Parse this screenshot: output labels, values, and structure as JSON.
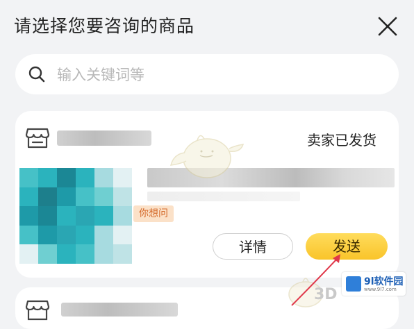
{
  "header": {
    "title": "请选择您要咨询的商品"
  },
  "search": {
    "placeholder": "输入关键词等"
  },
  "orders": [
    {
      "status": "卖家已发货",
      "ask_tag": "你想问",
      "detail_label": "详情",
      "send_label": "发送"
    }
  ],
  "watermark": {
    "brand": "9l软件园",
    "url": "www.9l7.com",
    "overlay": "3D"
  },
  "colors": {
    "send_button": "#f9c42a",
    "ask_tag_bg": "#fbe1c8",
    "ask_tag_text": "#d46a2a",
    "arrow": "#e0384a"
  },
  "icons": {
    "close": "close-icon",
    "search": "search-icon",
    "shop": "shop-icon"
  }
}
